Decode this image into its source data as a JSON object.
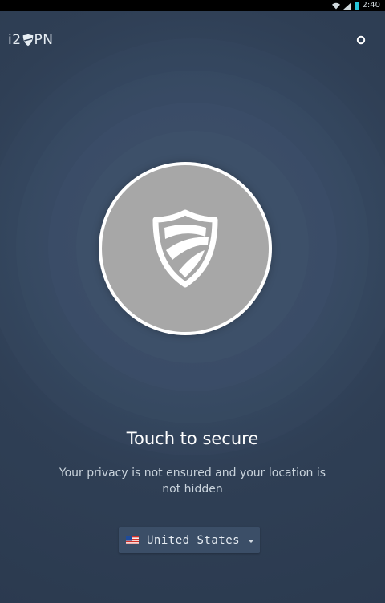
{
  "status_bar": {
    "time": "2:40"
  },
  "header": {
    "logo_left": "i2",
    "logo_right": "PN"
  },
  "main": {
    "title": "Touch to secure",
    "subtitle": "Your privacy is not ensured and your location is not hidden"
  },
  "country": {
    "selected": "United States"
  },
  "colors": {
    "background": "#2f3f55",
    "button_fill": "#a7a7a7",
    "button_border": "#ffffff",
    "selector_bg": "#3b4e67"
  },
  "icons": {
    "logo": "shield-icon",
    "settings": "settings-dot-icon",
    "connect": "shield-icon",
    "flag": "us-flag-icon",
    "dropdown": "chevron-down-icon"
  }
}
